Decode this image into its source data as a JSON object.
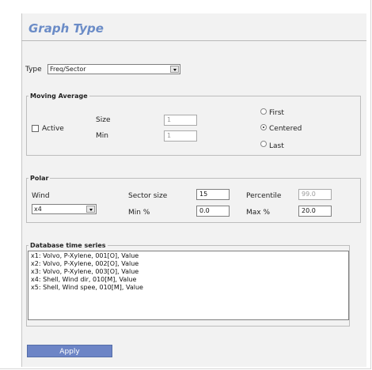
{
  "header": {
    "title": "Graph Type"
  },
  "type_row": {
    "label": "Type",
    "value": "Freq/Sector"
  },
  "moving_average": {
    "legend": "Moving Average",
    "active_label": "Active",
    "size_label": "Size",
    "size_value": "1",
    "min_label": "Min",
    "min_value": "1",
    "first_label": "First",
    "centered_label": "Centered",
    "last_label": "Last",
    "selected": "Centered"
  },
  "polar": {
    "legend": "Polar",
    "wind_label": "Wind",
    "wind_value": "x4",
    "sector_size_label": "Sector size",
    "sector_size_value": "15",
    "percentile_label": "Percentile",
    "percentile_value": "99.0",
    "min_pct_label": "Min %",
    "min_pct_value": "0.0",
    "max_pct_label": "Max %",
    "max_pct_value": "20.0"
  },
  "database": {
    "legend": "Database time series",
    "items": [
      "x1: Volvo, P-Xylene, 001[O], Value",
      "x2: Volvo, P-Xylene, 002[O], Value",
      "x3: Volvo, P-Xylene, 003[O], Value",
      "x4: Shell, Wind dir, 010[M], Value",
      "x5: Shell, Wind spee, 010[M], Value"
    ]
  },
  "actions": {
    "apply_label": "Apply"
  },
  "icons": {
    "dropdown": "chevron-down-icon"
  }
}
